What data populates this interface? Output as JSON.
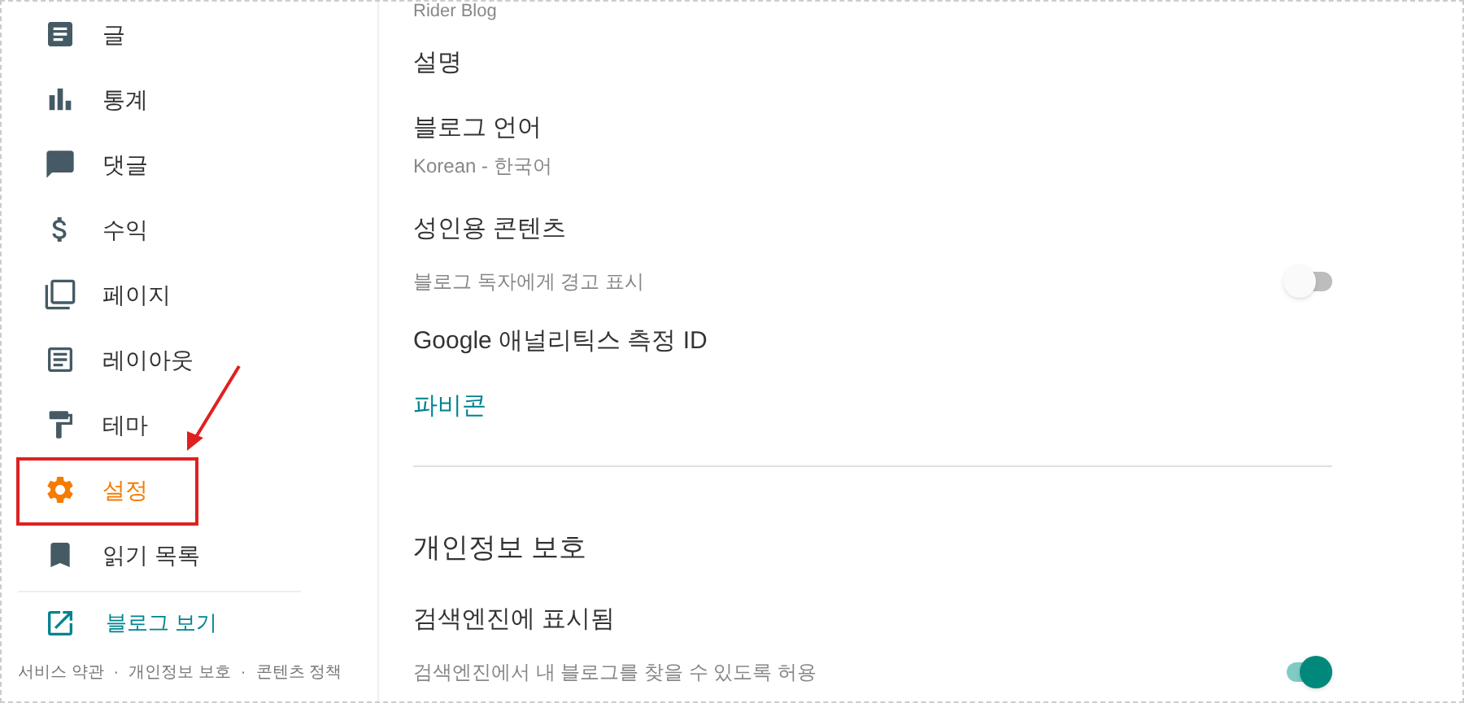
{
  "sidebar": {
    "items": [
      {
        "label": "글",
        "selected": false
      },
      {
        "label": "통계",
        "selected": false
      },
      {
        "label": "댓글",
        "selected": false
      },
      {
        "label": "수익",
        "selected": false
      },
      {
        "label": "페이지",
        "selected": false
      },
      {
        "label": "레이아웃",
        "selected": false
      },
      {
        "label": "테마",
        "selected": false
      },
      {
        "label": "설정",
        "selected": true
      },
      {
        "label": "읽기 목록",
        "selected": false
      }
    ],
    "view_blog": "블로그 보기",
    "footer_links": [
      "서비스 약관",
      "개인정보 보호",
      "콘텐츠 정책"
    ],
    "footer_separator": "·"
  },
  "settings": {
    "blog_title_value": "Rider Blog",
    "rows": [
      {
        "kind": "label",
        "title": "설명"
      },
      {
        "kind": "value",
        "title": "블로그 언어",
        "subtitle": "Korean - 한국어"
      },
      {
        "kind": "toggle",
        "title": "성인용 콘텐츠",
        "subtitle": "블로그 독자에게 경고 표시",
        "on": false
      },
      {
        "kind": "label",
        "title": "Google 애널리틱스 측정 ID"
      },
      {
        "kind": "link",
        "title": "파비콘"
      }
    ],
    "section_title": "개인정보 보호",
    "privacy_rows": [
      {
        "kind": "toggle",
        "title": "검색엔진에 표시됨",
        "subtitle": "검색엔진에서 내 블로그를 찾을 수 있도록 허용",
        "on": true
      }
    ]
  }
}
